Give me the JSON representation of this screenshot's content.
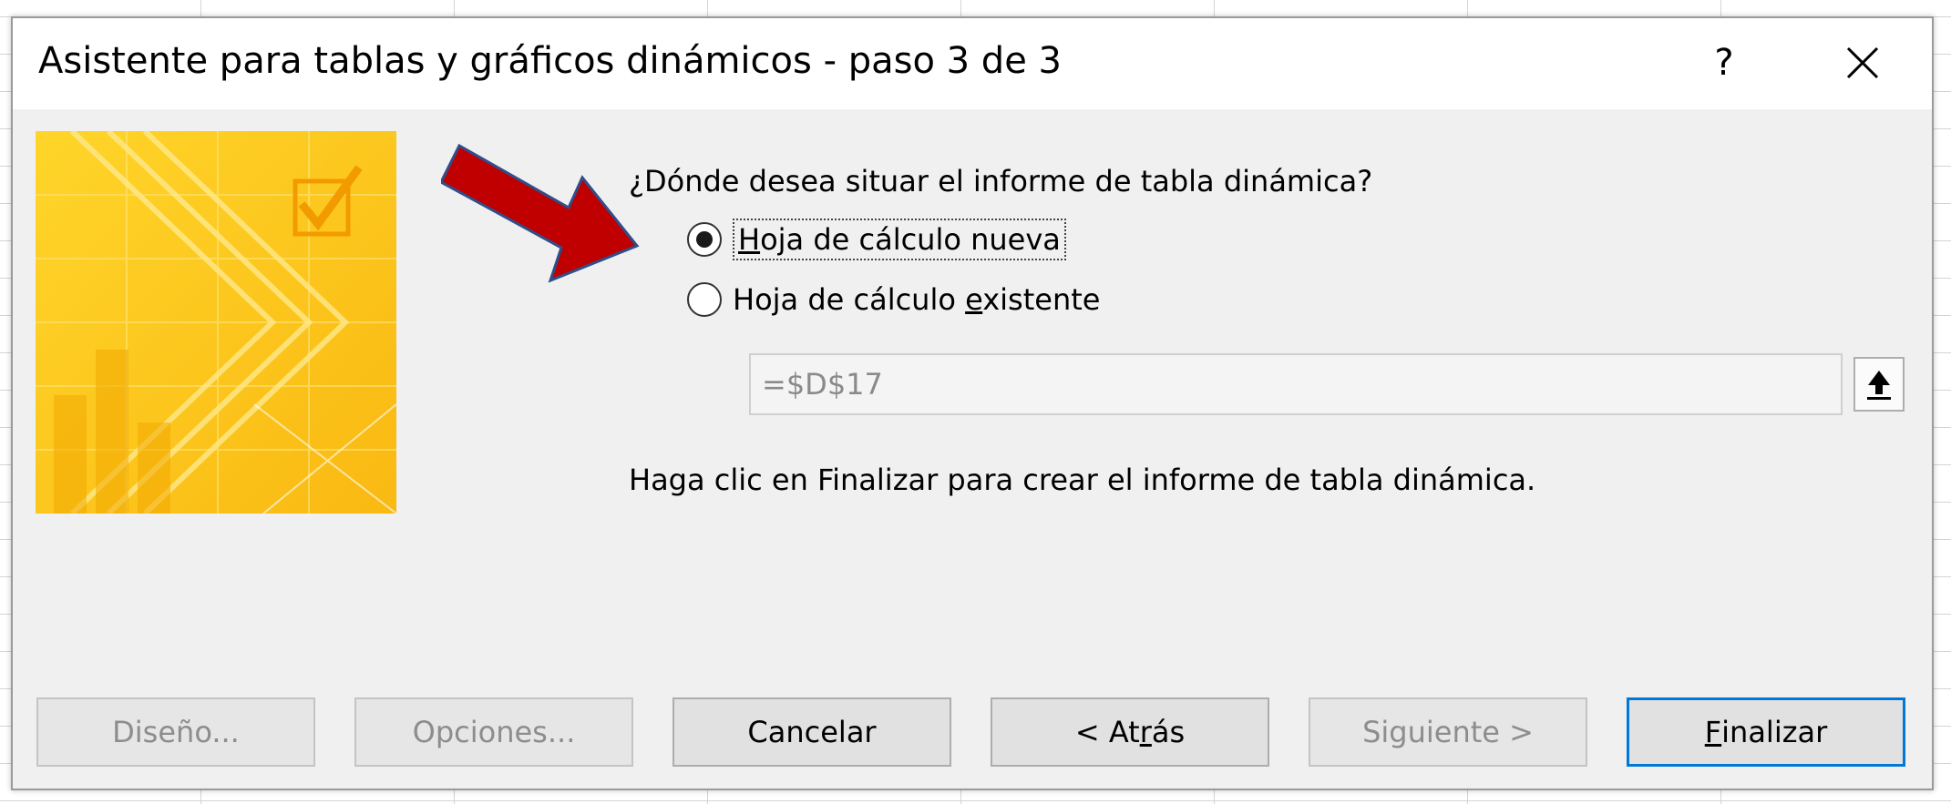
{
  "dialog": {
    "title": "Asistente para tablas y gráficos dinámicos - paso 3 de 3",
    "help_label": "?",
    "close_icon": "close-icon"
  },
  "main": {
    "question": "¿Dónde desea situar el informe de tabla dinámica?",
    "options": [
      {
        "label_pre": "",
        "label_underlined": "H",
        "label_post": "oja de cálculo nueva",
        "checked": true
      },
      {
        "label_pre": "Hoja de cálculo ",
        "label_underlined": "e",
        "label_post": "xistente",
        "checked": false
      }
    ],
    "location_value": "=$D$17",
    "collapse_icon": "collapse-dialog-icon",
    "finish_hint": "Haga clic en Finalizar para crear el informe de tabla dinámica."
  },
  "buttons": {
    "design": "Diseño...",
    "options": "Opciones...",
    "cancel": "Cancelar",
    "back_pre": "< At",
    "back_underlined": "r",
    "back_post": "ás",
    "next": "Siguiente >",
    "finish_underlined": "F",
    "finish_post": "inalizar"
  },
  "colors": {
    "accent": "#0078d7",
    "annotation_arrow": "#c00000",
    "wizard_image_yellow": "#fcc419"
  }
}
